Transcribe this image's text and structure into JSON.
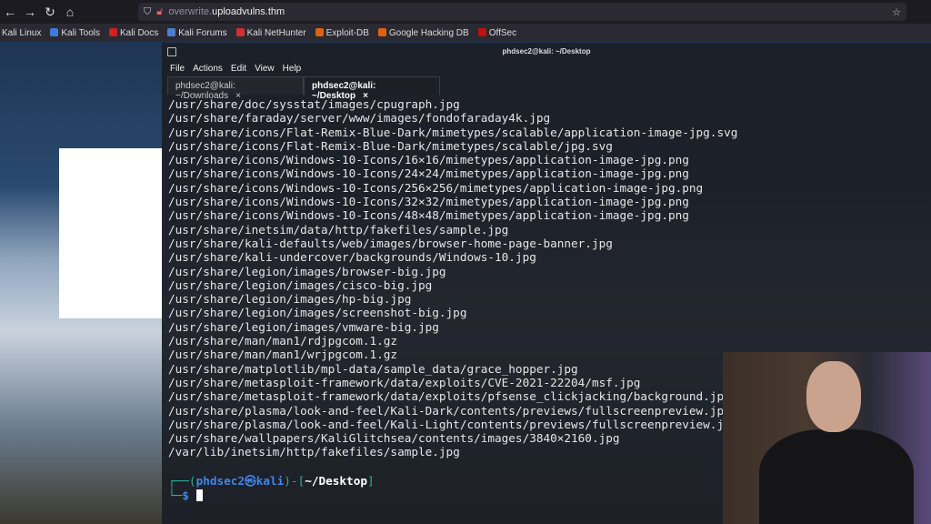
{
  "browser": {
    "url_prefix": "overwrite.",
    "url_domain": "uploadvulns.thm",
    "bookmarks": [
      {
        "label": "Kali Linux",
        "color": "#2b2a33"
      },
      {
        "label": "Kali Tools",
        "color": "#3b7dd8"
      },
      {
        "label": "Kali Docs",
        "color": "#d02020"
      },
      {
        "label": "Kali Forums",
        "color": "#4a7fd0"
      },
      {
        "label": "Kali NetHunter",
        "color": "#d03030"
      },
      {
        "label": "Exploit-DB",
        "color": "#e06010"
      },
      {
        "label": "Google Hacking DB",
        "color": "#e06010"
      },
      {
        "label": "OffSec",
        "color": "#c01010"
      }
    ]
  },
  "terminal": {
    "title": "phdsec2@kali: ~/Desktop",
    "menu": [
      "File",
      "Actions",
      "Edit",
      "View",
      "Help"
    ],
    "tabs": [
      {
        "label": "phdsec2@kali: ~/Downloads"
      },
      {
        "label": "phdsec2@kali: ~/Desktop"
      }
    ],
    "output": [
      "/usr/share/doc/sysstat/images/cpugraph.jpg",
      "/usr/share/faraday/server/www/images/fondofaraday4k.jpg",
      "/usr/share/icons/Flat-Remix-Blue-Dark/mimetypes/scalable/application-image-jpg.svg",
      "/usr/share/icons/Flat-Remix-Blue-Dark/mimetypes/scalable/jpg.svg",
      "/usr/share/icons/Windows-10-Icons/16×16/mimetypes/application-image-jpg.png",
      "/usr/share/icons/Windows-10-Icons/24×24/mimetypes/application-image-jpg.png",
      "/usr/share/icons/Windows-10-Icons/256×256/mimetypes/application-image-jpg.png",
      "/usr/share/icons/Windows-10-Icons/32×32/mimetypes/application-image-jpg.png",
      "/usr/share/icons/Windows-10-Icons/48×48/mimetypes/application-image-jpg.png",
      "/usr/share/inetsim/data/http/fakefiles/sample.jpg",
      "/usr/share/kali-defaults/web/images/browser-home-page-banner.jpg",
      "/usr/share/kali-undercover/backgrounds/Windows-10.jpg",
      "/usr/share/legion/images/browser-big.jpg",
      "/usr/share/legion/images/cisco-big.jpg",
      "/usr/share/legion/images/hp-big.jpg",
      "/usr/share/legion/images/screenshot-big.jpg",
      "/usr/share/legion/images/vmware-big.jpg",
      "/usr/share/man/man1/rdjpgcom.1.gz",
      "/usr/share/man/man1/wrjpgcom.1.gz",
      "/usr/share/matplotlib/mpl-data/sample_data/grace_hopper.jpg",
      "/usr/share/metasploit-framework/data/exploits/CVE-2021-22204/msf.jpg",
      "/usr/share/metasploit-framework/data/exploits/pfsense_clickjacking/background.jp",
      "/usr/share/plasma/look-and-feel/Kali-Dark/contents/previews/fullscreenpreview.jp",
      "/usr/share/plasma/look-and-feel/Kali-Light/contents/previews/fullscreenpreview.j",
      "/usr/share/wallpapers/KaliGlitchsea/contents/images/3840×2160.jpg",
      "/var/lib/inetsim/http/fakefiles/sample.jpg"
    ],
    "prompt": {
      "user": "phdsec2",
      "at": "㉿",
      "host": "kali",
      "path": "~/Desktop",
      "symbol": "$"
    }
  }
}
